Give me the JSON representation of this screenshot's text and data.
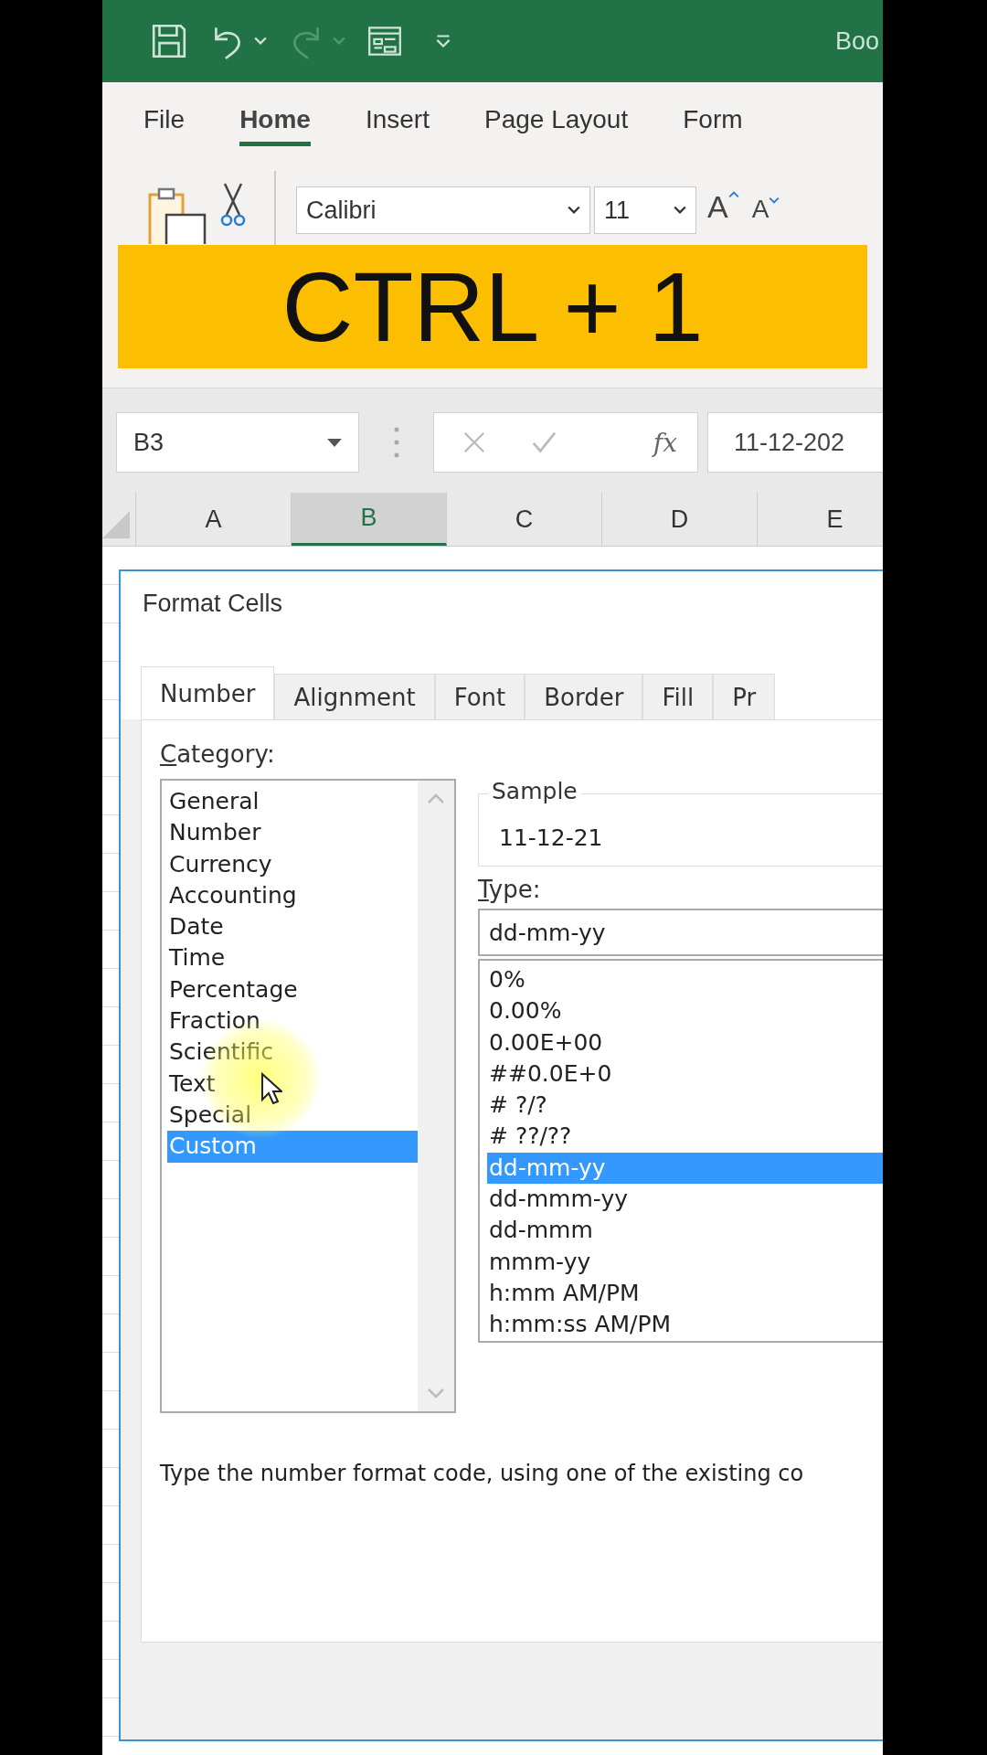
{
  "title_bar": {
    "title": "Boo"
  },
  "ribbon_tabs": [
    {
      "label": "File",
      "selected": false
    },
    {
      "label": "Home",
      "selected": true
    },
    {
      "label": "Insert",
      "selected": false
    },
    {
      "label": "Page Layout",
      "selected": false
    },
    {
      "label": "Form",
      "selected": false
    }
  ],
  "font_group": {
    "font": "Calibri",
    "size": "11",
    "grow": "A",
    "shrink": "A"
  },
  "overlay_banner": "CTRL + 1",
  "formula_bar": {
    "name_box": "B3",
    "fx": "fx",
    "value": "11-12-202"
  },
  "column_headers": [
    {
      "label": "A",
      "selected": false
    },
    {
      "label": "B",
      "selected": true
    },
    {
      "label": "C",
      "selected": false
    },
    {
      "label": "D",
      "selected": false
    },
    {
      "label": "E",
      "selected": false
    }
  ],
  "dialog": {
    "title": "Format Cells",
    "tabs": [
      {
        "label": "Number",
        "selected": true
      },
      {
        "label": "Alignment",
        "selected": false
      },
      {
        "label": "Font",
        "selected": false
      },
      {
        "label": "Border",
        "selected": false
      },
      {
        "label": "Fill",
        "selected": false
      },
      {
        "label": "Pr",
        "selected": false
      }
    ],
    "category_label": "Category:",
    "categories": [
      {
        "label": "General",
        "selected": false
      },
      {
        "label": "Number",
        "selected": false
      },
      {
        "label": "Currency",
        "selected": false
      },
      {
        "label": "Accounting",
        "selected": false
      },
      {
        "label": "Date",
        "selected": false
      },
      {
        "label": "Time",
        "selected": false
      },
      {
        "label": "Percentage",
        "selected": false
      },
      {
        "label": "Fraction",
        "selected": false
      },
      {
        "label": "Scientific",
        "selected": false
      },
      {
        "label": "Text",
        "selected": false
      },
      {
        "label": "Special",
        "selected": false
      },
      {
        "label": "Custom",
        "selected": true
      }
    ],
    "sample_label": "Sample",
    "sample": "11-12-21",
    "type_label": "Type:",
    "type_value": "dd-mm-yy",
    "types": [
      {
        "label": "0%",
        "selected": false
      },
      {
        "label": "0.00%",
        "selected": false
      },
      {
        "label": "0.00E+00",
        "selected": false
      },
      {
        "label": "##0.0E+0",
        "selected": false
      },
      {
        "label": "# ?/?",
        "selected": false
      },
      {
        "label": "# ??/??",
        "selected": false
      },
      {
        "label": "dd-mm-yy",
        "selected": true
      },
      {
        "label": "dd-mmm-yy",
        "selected": false
      },
      {
        "label": "dd-mmm",
        "selected": false
      },
      {
        "label": "mmm-yy",
        "selected": false
      },
      {
        "label": "h:mm AM/PM",
        "selected": false
      },
      {
        "label": "h:mm:ss AM/PM",
        "selected": false
      }
    ],
    "description": "Type the number format code, using one of the existing co"
  }
}
